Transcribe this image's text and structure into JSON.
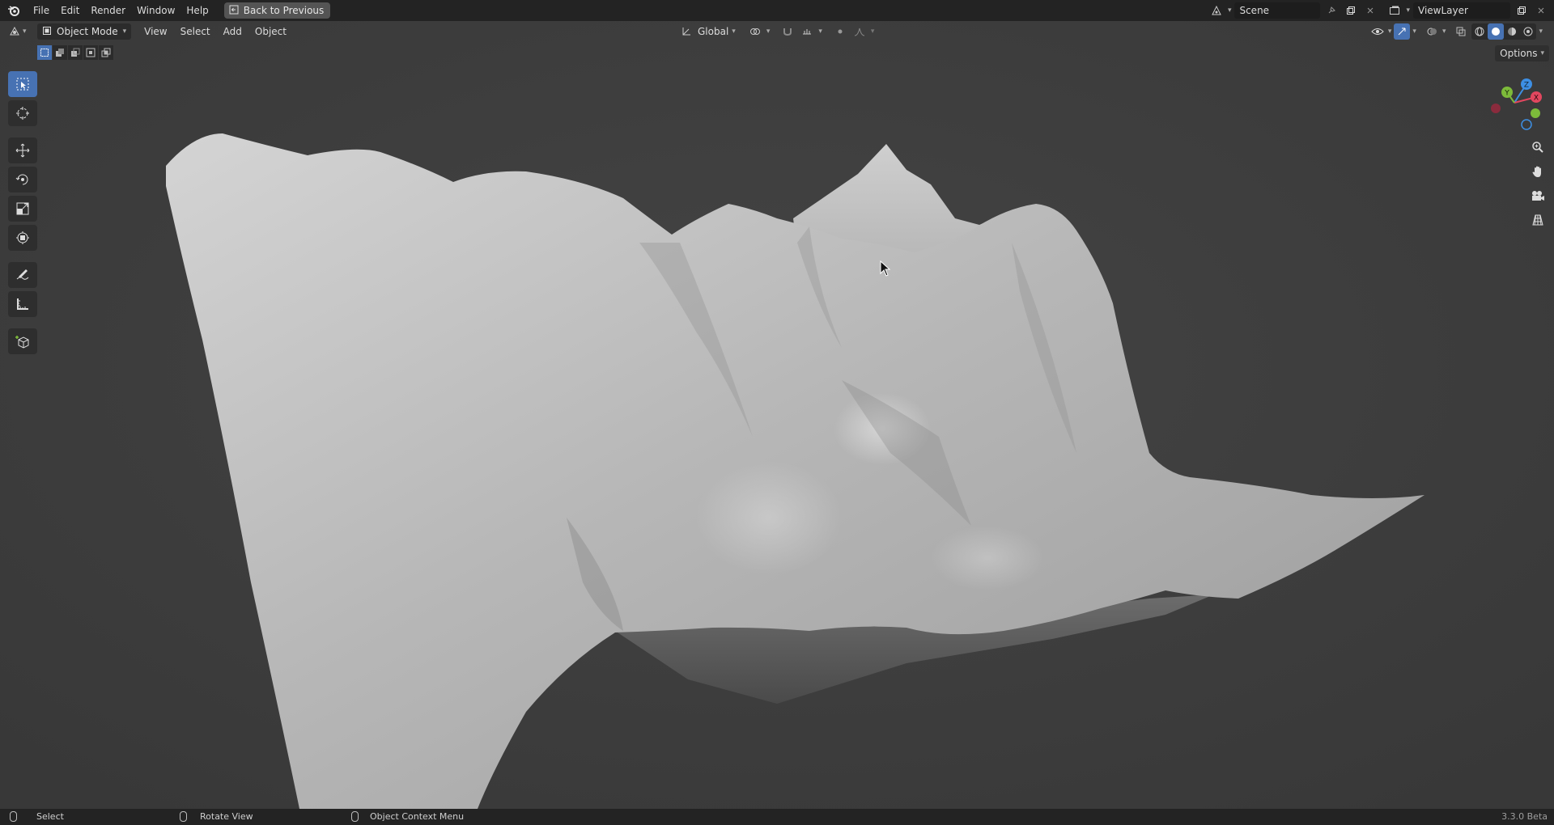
{
  "menubar": {
    "items": [
      "File",
      "Edit",
      "Render",
      "Window",
      "Help"
    ],
    "back_button": "Back to Previous",
    "scene": "Scene",
    "view_layer": "ViewLayer"
  },
  "viewport_header": {
    "mode": "Object Mode",
    "menus": [
      "View",
      "Select",
      "Add",
      "Object"
    ],
    "transform_orientation": "Global",
    "options": "Options"
  },
  "gizmo": {
    "x": "X",
    "y": "Y",
    "z": "Z"
  },
  "statusbar": {
    "select": "Select",
    "rotate": "Rotate View",
    "context": "Object Context Menu",
    "version": "3.3.0 Beta"
  },
  "colors": {
    "accent": "#4772b3",
    "x_axis": "#e2475f",
    "y_axis": "#7dbb3a",
    "z_axis": "#3d8fe4"
  }
}
